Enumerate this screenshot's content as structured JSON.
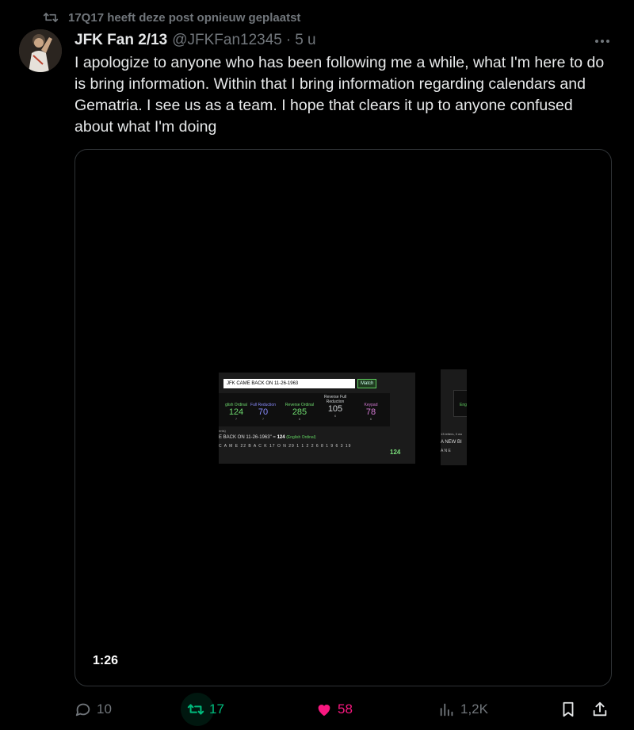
{
  "repost_banner": {
    "text": "17Q17 heeft deze post opnieuw geplaatst"
  },
  "post": {
    "author_name": "JFK Fan 2/13",
    "handle": "@JFKFan12345",
    "separator": "·",
    "time": "5 u",
    "text": "I apologize to anyone who has been following me a while, what I'm here to do is bring information. Within that I bring information regarding calendars and Gematria. I see us as a team. I hope that clears it up to anyone confused about what I'm doing"
  },
  "video": {
    "duration": "1:26",
    "frame": {
      "input_value": "JFK CAME BACK ON 11-26-1963",
      "button_label": "Match",
      "ciphers": [
        {
          "label": "glish Ordinal",
          "value": "124",
          "sub": "7",
          "color": "#6fdc6f"
        },
        {
          "label": "Full Reduction",
          "value": "70",
          "sub": "7",
          "color": "#8a8cff"
        },
        {
          "label": "Reverse Ordinal",
          "value": "285",
          "sub": "6",
          "color": "#6fdc6f"
        },
        {
          "label": "Reverse Full Reduction",
          "value": "105",
          "sub": "6",
          "color": "#cfd2d4"
        },
        {
          "label": "Keypad",
          "value": "78",
          "sub": "6",
          "color": "#d47ad4"
        }
      ],
      "word_count": "ents)",
      "equation_prefix": "E BACK ON 11-26-1963\" = ",
      "equation_total": "124",
      "equation_cipher": "(English Ordinal)",
      "letters_line": "C A M E  22  B A C K  17  O N  29  1 1  2  2 6  8  1 9 6 3  19",
      "grand_total": "124"
    },
    "frame2": {
      "box_label": "Eng",
      "line1": "13 letters, 3 wo",
      "line2": "A NEW BI",
      "line3": "A   N E"
    }
  },
  "actions": {
    "replies": "10",
    "reposts": "17",
    "likes": "58",
    "views": "1,2K"
  },
  "colors": {
    "repost_green": "#00ba7c",
    "like_pink": "#f91880",
    "muted": "#71767b"
  }
}
